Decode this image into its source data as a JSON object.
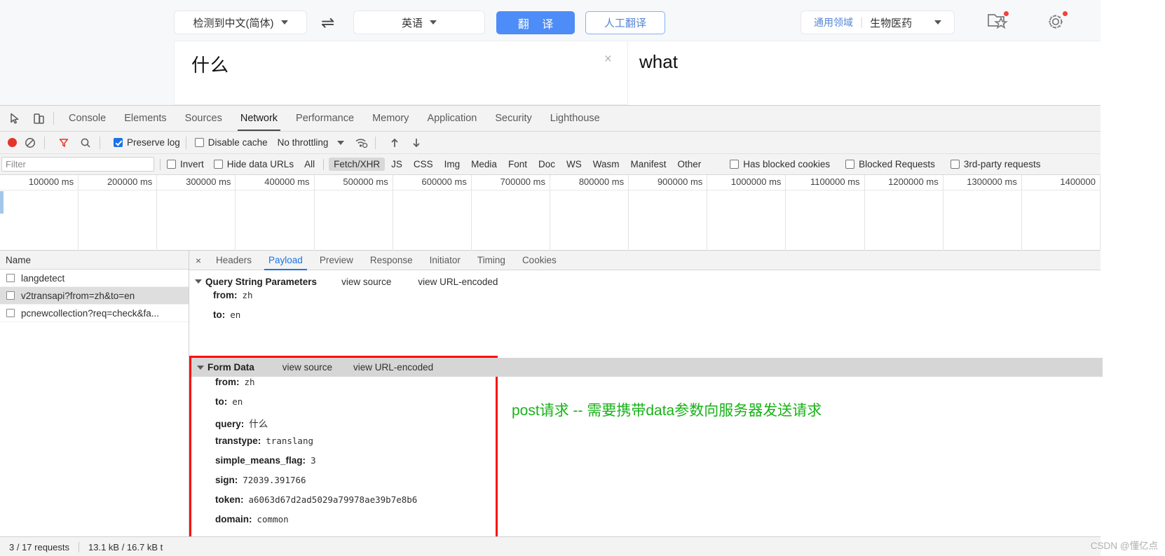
{
  "translator": {
    "lang_from": "检测到中文(简体)",
    "lang_to": "英语",
    "swap_icon": "⇌",
    "translate_button": "翻 译",
    "human_translate_button": "人工翻译",
    "domain_generic": "通用领域",
    "domain_selected": "生物医药",
    "favorites_icon": "folder-star-icon",
    "settings_icon": "gear-icon",
    "source_text": "什么",
    "target_text": "what",
    "clear_icon": "×"
  },
  "devtools": {
    "inspect_icon": "inspect-element-icon",
    "device_icon": "device-toolbar-icon",
    "tabs": [
      {
        "label": "Console",
        "active": false
      },
      {
        "label": "Elements",
        "active": false
      },
      {
        "label": "Sources",
        "active": false
      },
      {
        "label": "Network",
        "active": true
      },
      {
        "label": "Performance",
        "active": false
      },
      {
        "label": "Memory",
        "active": false
      },
      {
        "label": "Application",
        "active": false
      },
      {
        "label": "Security",
        "active": false
      },
      {
        "label": "Lighthouse",
        "active": false
      }
    ],
    "network_toolbar": {
      "record_label": "record-button",
      "clear_label": "clear-button",
      "filter_label": "filter-button",
      "search_label": "search-button",
      "preserve_log_label": "Preserve log",
      "preserve_log_checked": true,
      "disable_cache_label": "Disable cache",
      "disable_cache_checked": false,
      "throttling_value": "No throttling",
      "wifi_label": "network-conditions-icon",
      "import_label": "import-har-icon",
      "export_label": "export-har-icon"
    },
    "filter_bar": {
      "filter_placeholder": "Filter",
      "invert_label": "Invert",
      "invert_checked": false,
      "hide_data_urls_label": "Hide data URLs",
      "hide_data_urls_checked": false,
      "types": [
        {
          "label": "All",
          "selected": false
        },
        {
          "label": "Fetch/XHR",
          "selected": true
        },
        {
          "label": "JS",
          "selected": false
        },
        {
          "label": "CSS",
          "selected": false
        },
        {
          "label": "Img",
          "selected": false
        },
        {
          "label": "Media",
          "selected": false
        },
        {
          "label": "Font",
          "selected": false
        },
        {
          "label": "Doc",
          "selected": false
        },
        {
          "label": "WS",
          "selected": false
        },
        {
          "label": "Wasm",
          "selected": false
        },
        {
          "label": "Manifest",
          "selected": false
        },
        {
          "label": "Other",
          "selected": false
        }
      ],
      "has_blocked_cookies_label": "Has blocked cookies",
      "has_blocked_cookies_checked": false,
      "blocked_requests_label": "Blocked Requests",
      "blocked_requests_checked": false,
      "third_party_label": "3rd-party requests",
      "third_party_checked": false
    },
    "overview_ticks": [
      "100000 ms",
      "200000 ms",
      "300000 ms",
      "400000 ms",
      "500000 ms",
      "600000 ms",
      "700000 ms",
      "800000 ms",
      "900000 ms",
      "1000000 ms",
      "1100000 ms",
      "1200000 ms",
      "1300000 ms",
      "1400000"
    ],
    "requests_header": "Name",
    "requests": [
      {
        "name": "langdetect",
        "selected": false
      },
      {
        "name": "v2transapi?from=zh&to=en",
        "selected": true
      },
      {
        "name": "pcnewcollection?req=check&fa...",
        "selected": false
      }
    ],
    "detail_tabs": [
      {
        "label": "Headers",
        "active": false
      },
      {
        "label": "Payload",
        "active": true
      },
      {
        "label": "Preview",
        "active": false
      },
      {
        "label": "Response",
        "active": false
      },
      {
        "label": "Initiator",
        "active": false
      },
      {
        "label": "Timing",
        "active": false
      },
      {
        "label": "Cookies",
        "active": false
      }
    ],
    "detail_close_icon": "×",
    "query_string": {
      "title": "Query String Parameters",
      "view_source": "view source",
      "view_url_encoded": "view URL-encoded",
      "params": [
        {
          "key": "from:",
          "value": "zh"
        },
        {
          "key": "to:",
          "value": "en"
        }
      ]
    },
    "form_data": {
      "title": "Form Data",
      "view_source": "view source",
      "view_url_encoded": "view URL-encoded",
      "params": [
        {
          "key": "from:",
          "value": "zh",
          "cjk": false
        },
        {
          "key": "to:",
          "value": "en",
          "cjk": false
        },
        {
          "key": "query:",
          "value": "什么",
          "cjk": true
        },
        {
          "key": "transtype:",
          "value": "translang",
          "cjk": false
        },
        {
          "key": "simple_means_flag:",
          "value": "3",
          "cjk": false
        },
        {
          "key": "sign:",
          "value": "72039.391766",
          "cjk": false
        },
        {
          "key": "token:",
          "value": "a6063d67d2ad5029a79978ae39b7e8b6",
          "cjk": false
        },
        {
          "key": "domain:",
          "value": "common",
          "cjk": false
        }
      ],
      "highlight_color": "#fa0f00"
    },
    "annotation": {
      "text": "post请求 -- 需要携带data参数向服务器发送请求",
      "color": "#17b217"
    },
    "status_bar": {
      "requests_count": "3 / 17 requests",
      "transferred": "13.1 kB / 16.7 kB t"
    }
  },
  "watermark": "CSDN @懂亿点"
}
